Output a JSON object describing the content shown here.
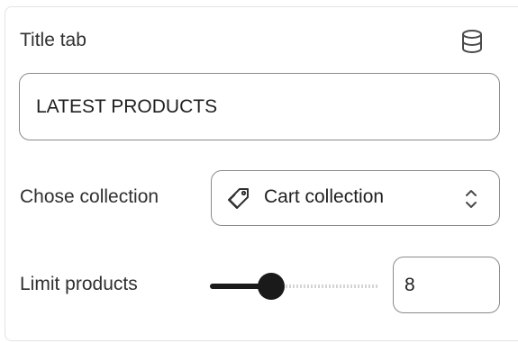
{
  "title_tab": {
    "label": "Title tab",
    "icon": "database-icon",
    "input_value": "LATEST PRODUCTS"
  },
  "collection": {
    "label": "Chose collection",
    "icon": "tag-icon",
    "selected": "Cart collection",
    "chevron": "select-chevron-icon"
  },
  "limit": {
    "label": "Limit products",
    "slider_fraction": 0.36,
    "value": "8"
  },
  "colors": {
    "border": "#8a8a8a",
    "slider_active": "#1a1a1a",
    "slider_inactive": "#d4d4d4",
    "text": "#303030"
  }
}
